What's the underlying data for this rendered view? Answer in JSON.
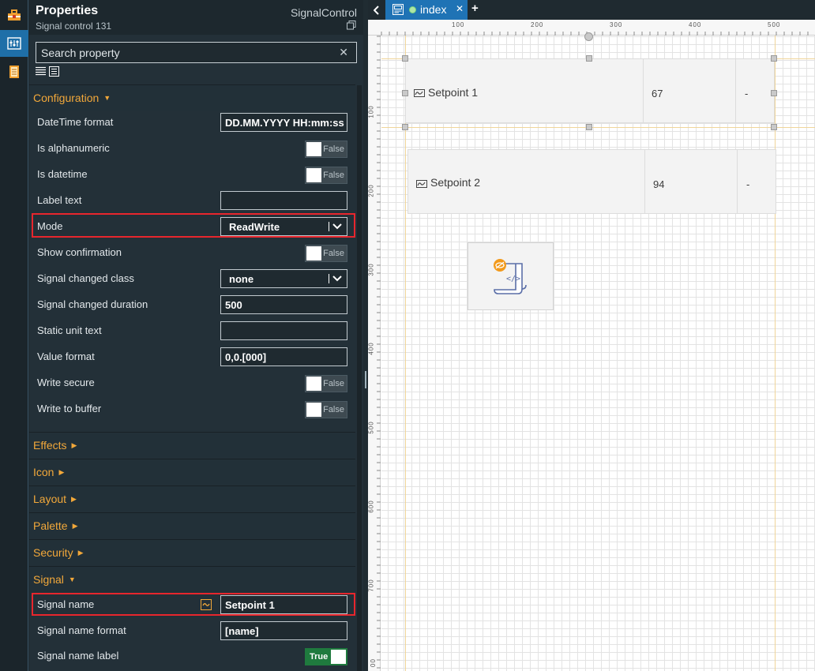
{
  "properties": {
    "title": "Properties",
    "subtitle": "Signal control 131",
    "control_type": "SignalControl",
    "search_placeholder": "Search property"
  },
  "sections": {
    "configuration": "Configuration",
    "effects": "Effects",
    "icon": "Icon",
    "layout": "Layout",
    "palette": "Palette",
    "security": "Security",
    "signal": "Signal"
  },
  "config_rows": {
    "datetime_format": {
      "label": "DateTime format",
      "value": "DD.MM.YYYY HH:mm:ss"
    },
    "is_alphanumeric": {
      "label": "Is alphanumeric",
      "value": "False"
    },
    "is_datetime": {
      "label": "Is datetime",
      "value": "False"
    },
    "label_text": {
      "label": "Label text",
      "value": ""
    },
    "mode": {
      "label": "Mode",
      "value": "ReadWrite"
    },
    "show_confirmation": {
      "label": "Show confirmation",
      "value": "False"
    },
    "signal_changed_class": {
      "label": "Signal changed class",
      "value": "none"
    },
    "signal_changed_duration": {
      "label": "Signal changed duration",
      "value": "500"
    },
    "static_unit_text": {
      "label": "Static unit text",
      "value": ""
    },
    "value_format": {
      "label": "Value format",
      "value": "0,0.[000]"
    },
    "write_secure": {
      "label": "Write secure",
      "value": "False"
    },
    "write_to_buffer": {
      "label": "Write to buffer",
      "value": "False"
    }
  },
  "signal_rows": {
    "signal_name": {
      "label": "Signal name",
      "value": "Setpoint 1"
    },
    "signal_name_format": {
      "label": "Signal name format",
      "value": "[name]"
    },
    "signal_name_label": {
      "label": "Signal name label",
      "value": "True"
    }
  },
  "editor": {
    "tab_name": "index",
    "ruler_top": [
      "100",
      "200",
      "300",
      "400",
      "500"
    ],
    "ruler_left": [
      "100",
      "200",
      "300",
      "400",
      "500",
      "600",
      "700",
      "00"
    ],
    "signals": [
      {
        "name": "Setpoint 1",
        "value": "67",
        "unit": "-"
      },
      {
        "name": "Setpoint 2",
        "value": "94",
        "unit": "-"
      }
    ]
  },
  "colors": {
    "accent": "#f2a83a",
    "tab_active": "#1f73b5",
    "highlight": "#e8262d",
    "toggle_on": "#1f7a3e"
  }
}
